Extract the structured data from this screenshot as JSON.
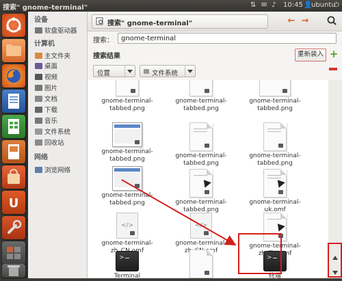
{
  "topbar": {
    "title": "搜索\" gnome-terminal\"",
    "time": "10:45",
    "user": "ubuntu"
  },
  "window": {
    "path_label": "搜索\" gnome-terminal\"",
    "back_arrow": "←",
    "forward_arrow": "→"
  },
  "search": {
    "label": "搜索：",
    "value": "gnome-terminal"
  },
  "results": {
    "heading": "搜索结果",
    "reload_label": "重新装入",
    "add_symbol": "+",
    "location_combo": "位置",
    "filesystem_combo": "文件系统"
  },
  "sidebar": {
    "devices_header": "设备",
    "devices": [
      {
        "label": "软盘驱动器",
        "icon": "floppy-icon"
      }
    ],
    "computer_header": "计算机",
    "computer": [
      {
        "label": "主文件夹",
        "icon": "home-folder-icon"
      },
      {
        "label": "桌面",
        "icon": "desktop-icon"
      },
      {
        "label": "视频",
        "icon": "video-icon"
      },
      {
        "label": "图片",
        "icon": "picture-icon"
      },
      {
        "label": "文档",
        "icon": "document-icon"
      },
      {
        "label": "下载",
        "icon": "download-icon"
      },
      {
        "label": "音乐",
        "icon": "music-icon"
      },
      {
        "label": "文件系统",
        "icon": "filesystem-icon"
      },
      {
        "label": "回收站",
        "icon": "trash-icon"
      }
    ],
    "network_header": "网络",
    "network": [
      {
        "label": "浏览网络",
        "icon": "network-icon"
      }
    ]
  },
  "files": [
    {
      "name": "gnome-terminal-tabbed.png",
      "kind": "doc"
    },
    {
      "name": "gnome-terminal-tabbed.png",
      "kind": "doc"
    },
    {
      "name": "gnome-terminal-tabbed.png",
      "kind": "doc"
    },
    {
      "name": "gnome-terminal-tabbed.png",
      "kind": "shot"
    },
    {
      "name": "gnome-terminal-tabbed.png",
      "kind": "doc"
    },
    {
      "name": "gnome-terminal-tabbed.png",
      "kind": "doc"
    },
    {
      "name": "gnome-terminal-tabbed.png",
      "kind": "shot"
    },
    {
      "name": "gnome-terminal-tabbed.png",
      "kind": "doc"
    },
    {
      "name": "gnome-terminal-uk.omf",
      "kind": "doc"
    },
    {
      "name": "gnome-terminal-zh_CN.omf",
      "kind": "omf"
    },
    {
      "name": "gnome-terminal-zh_CN.omf",
      "kind": "omf"
    },
    {
      "name": "gnome-terminal-zh_TW.omf",
      "kind": "doc"
    },
    {
      "name": "Terminal",
      "kind": "term"
    },
    {
      "name": "ubuntu-gnome-terminal",
      "kind": "doc"
    },
    {
      "name": "终端",
      "kind": "term"
    }
  ],
  "colors": {
    "accent": "#e2622b",
    "highlight": "#d3201d",
    "add": "#5aa02c"
  }
}
